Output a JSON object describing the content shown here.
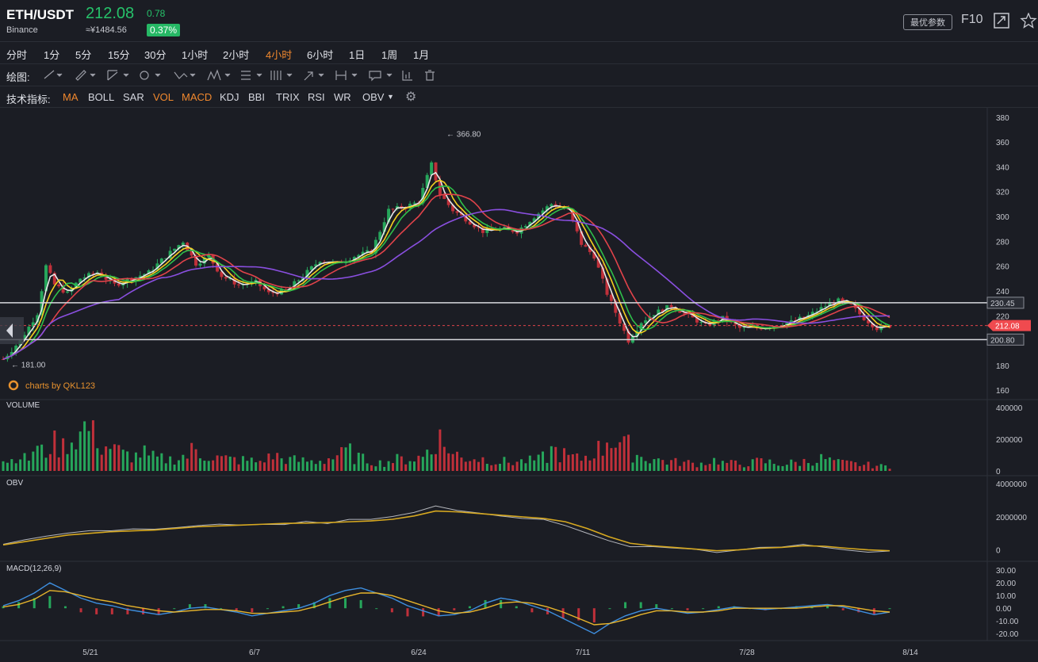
{
  "header": {
    "pair": "ETH/USDT",
    "exchange": "Binance",
    "price": "212.08",
    "change": "0.78",
    "cny": "≈¥1484.56",
    "change_pct": "0.37%",
    "param_button": "最优参数",
    "f10": "F10"
  },
  "timeframes": {
    "items": [
      "分时",
      "1分",
      "5分",
      "15分",
      "30分",
      "1小时",
      "2小时",
      "4小时",
      "6小时",
      "1日",
      "1周",
      "1月"
    ],
    "active": "4小时"
  },
  "drawing": {
    "label": "绘图:"
  },
  "indicators": {
    "label": "技术指标:",
    "items": [
      "MA",
      "BOLL",
      "SAR",
      "VOL",
      "MACD",
      "KDJ",
      "BBI",
      "TRIX",
      "RSI",
      "WR",
      "OBV"
    ],
    "active": [
      "MA",
      "VOL",
      "MACD"
    ]
  },
  "watermark": "charts by QKL123",
  "colors": {
    "up": "#26a65b",
    "down": "#c0303a",
    "ma_white": "#e9e9e9",
    "ma_yellow": "#f5d020",
    "ma_green": "#2fbf4a",
    "ma_red": "#e0434a",
    "ma_purple": "#8a4fe0",
    "obv_line": "#b5b7bd",
    "obv_ma": "#d6a820",
    "dif": "#3e8fe0",
    "dea": "#e8b52c"
  },
  "chart_data": [
    {
      "type": "candlestick",
      "title": "",
      "x_ticks": [
        "5/21",
        "6/7",
        "6/24",
        "7/11",
        "7/28",
        "8/14"
      ],
      "y_ticks": [
        160,
        180,
        200,
        220,
        240,
        260,
        280,
        300,
        320,
        340,
        360,
        380
      ],
      "ylim": [
        155,
        385
      ],
      "high_marker": "← 366.80",
      "low_marker": "← 181.00",
      "horizontal_levels": [
        {
          "label": "230.45",
          "value": 230.45
        },
        {
          "label": "200.80",
          "value": 200.8
        },
        {
          "label": "212.08",
          "value": 212.08
        }
      ],
      "close_series": [
        {
          "x": 0,
          "y": 185
        },
        {
          "x": 4,
          "y": 200
        },
        {
          "x": 8,
          "y": 222
        },
        {
          "x": 10,
          "y": 260
        },
        {
          "x": 12,
          "y": 245
        },
        {
          "x": 15,
          "y": 238
        },
        {
          "x": 18,
          "y": 250
        },
        {
          "x": 22,
          "y": 255
        },
        {
          "x": 26,
          "y": 245
        },
        {
          "x": 30,
          "y": 250
        },
        {
          "x": 34,
          "y": 255
        },
        {
          "x": 38,
          "y": 268
        },
        {
          "x": 42,
          "y": 280
        },
        {
          "x": 45,
          "y": 262
        },
        {
          "x": 48,
          "y": 268
        },
        {
          "x": 51,
          "y": 252
        },
        {
          "x": 55,
          "y": 245
        },
        {
          "x": 59,
          "y": 247
        },
        {
          "x": 62,
          "y": 238
        },
        {
          "x": 66,
          "y": 240
        },
        {
          "x": 70,
          "y": 252
        },
        {
          "x": 74,
          "y": 265
        },
        {
          "x": 78,
          "y": 262
        },
        {
          "x": 82,
          "y": 268
        },
        {
          "x": 86,
          "y": 272
        },
        {
          "x": 90,
          "y": 305
        },
        {
          "x": 94,
          "y": 308
        },
        {
          "x": 97,
          "y": 312
        },
        {
          "x": 100,
          "y": 342
        },
        {
          "x": 102,
          "y": 318
        },
        {
          "x": 105,
          "y": 305
        },
        {
          "x": 108,
          "y": 298
        },
        {
          "x": 112,
          "y": 288
        },
        {
          "x": 116,
          "y": 290
        },
        {
          "x": 120,
          "y": 288
        },
        {
          "x": 124,
          "y": 300
        },
        {
          "x": 128,
          "y": 310
        },
        {
          "x": 132,
          "y": 305
        },
        {
          "x": 135,
          "y": 278
        },
        {
          "x": 138,
          "y": 268
        },
        {
          "x": 141,
          "y": 238
        },
        {
          "x": 144,
          "y": 215
        },
        {
          "x": 146,
          "y": 200
        },
        {
          "x": 149,
          "y": 215
        },
        {
          "x": 152,
          "y": 222
        },
        {
          "x": 156,
          "y": 228
        },
        {
          "x": 160,
          "y": 220
        },
        {
          "x": 164,
          "y": 212
        },
        {
          "x": 168,
          "y": 218
        },
        {
          "x": 172,
          "y": 210
        },
        {
          "x": 176,
          "y": 210
        },
        {
          "x": 180,
          "y": 212
        },
        {
          "x": 184,
          "y": 215
        },
        {
          "x": 188,
          "y": 220
        },
        {
          "x": 192,
          "y": 228
        },
        {
          "x": 195,
          "y": 232
        },
        {
          "x": 198,
          "y": 228
        },
        {
          "x": 201,
          "y": 218
        },
        {
          "x": 204,
          "y": 210
        },
        {
          "x": 207,
          "y": 212
        }
      ]
    },
    {
      "type": "bar",
      "title": "VOLUME",
      "y_ticks": [
        0,
        200000,
        400000
      ],
      "ylim": [
        0,
        420000
      ],
      "values": [
        80000,
        120000,
        90000,
        160000,
        140000,
        200000,
        180000,
        230000,
        270000,
        320000,
        260000,
        180000,
        150000,
        120000,
        110000,
        130000,
        100000,
        90000,
        85000,
        95000,
        110000,
        150000,
        120000,
        100000,
        90000,
        85000,
        80000,
        75000,
        70000,
        95000,
        110000,
        90000,
        80000,
        75000,
        70000,
        80000,
        95000,
        120000,
        140000,
        100000,
        85000,
        70000,
        60000,
        75000,
        85000,
        90000,
        100000,
        160000,
        240000,
        180000,
        120000,
        95000,
        100000,
        90000,
        85000,
        70000,
        65000,
        70000,
        75000,
        80000,
        100000,
        150000,
        120000,
        100000,
        90000,
        110000,
        160000,
        250000,
        210000,
        180000,
        130000,
        100000,
        90000,
        80000,
        70000,
        65000,
        60000,
        55000,
        70000,
        80000,
        60000,
        55000,
        50000,
        60000,
        70000,
        65000,
        55000,
        50000,
        60000,
        70000,
        80000,
        90000,
        75000,
        60000,
        55000,
        50000,
        45000,
        40000,
        35000,
        30000
      ]
    },
    {
      "type": "line",
      "title": "OBV",
      "y_ticks": [
        0,
        2000000,
        4000000
      ],
      "ylim": [
        -500000,
        4200000
      ],
      "series": [
        {
          "values": [
            400000,
            600000,
            800000,
            1000000,
            1200000,
            1100000,
            1300000,
            1200000,
            1400000,
            1500000,
            1600000,
            1500000,
            1600000,
            1550000,
            1700000,
            1650000,
            1800000,
            1900000,
            2000000,
            2300000,
            2600000,
            2400000,
            2200000,
            2000000,
            1900000,
            1800000,
            1500000,
            1000000,
            500000,
            200000,
            150000,
            100000,
            0,
            -100000,
            50000,
            100000,
            200000,
            300000,
            200000,
            50000,
            -100000,
            -100000
          ]
        },
        {
          "values": [
            300000,
            500000,
            700000,
            900000,
            1000000,
            1100000,
            1150000,
            1200000,
            1300000,
            1400000,
            1450000,
            1500000,
            1550000,
            1600000,
            1620000,
            1650000,
            1700000,
            1750000,
            1850000,
            2050000,
            2350000,
            2300000,
            2200000,
            2100000,
            2000000,
            1900000,
            1700000,
            1300000,
            800000,
            400000,
            250000,
            150000,
            50000,
            -50000,
            0,
            100000,
            150000,
            250000,
            220000,
            100000,
            0,
            -50000
          ]
        }
      ]
    },
    {
      "type": "bar",
      "title": "MACD(12,26,9)",
      "y_ticks": [
        -20,
        -10,
        0,
        10,
        20,
        30
      ],
      "ylim": [
        -23,
        32
      ],
      "series": [
        {
          "name": "DIF",
          "values": [
            2,
            6,
            12,
            20,
            14,
            8,
            4,
            2,
            -1,
            -3,
            -5,
            -3,
            0,
            1,
            -1,
            -3,
            -6,
            -4,
            -2,
            0,
            4,
            10,
            14,
            16,
            12,
            8,
            2,
            -2,
            -6,
            -5,
            -2,
            4,
            8,
            6,
            2,
            -2,
            -8,
            -14,
            -20,
            -12,
            -6,
            -2,
            0,
            -2,
            -4,
            -3,
            -1,
            1,
            0,
            -1,
            0,
            1,
            2,
            3,
            1,
            -2,
            -5,
            -3
          ]
        },
        {
          "name": "DEA",
          "values": [
            1,
            3,
            7,
            14,
            13,
            10,
            7,
            5,
            2,
            0,
            -2,
            -3,
            -2,
            -1,
            -1,
            -2,
            -4,
            -4,
            -3,
            -2,
            1,
            5,
            9,
            12,
            12,
            10,
            6,
            2,
            -2,
            -4,
            -3,
            0,
            4,
            5,
            4,
            1,
            -3,
            -8,
            -13,
            -12,
            -9,
            -5,
            -2,
            -2,
            -3,
            -3,
            -2,
            0,
            0,
            0,
            0,
            0,
            1,
            2,
            2,
            0,
            -2,
            -3
          ]
        }
      ]
    }
  ]
}
